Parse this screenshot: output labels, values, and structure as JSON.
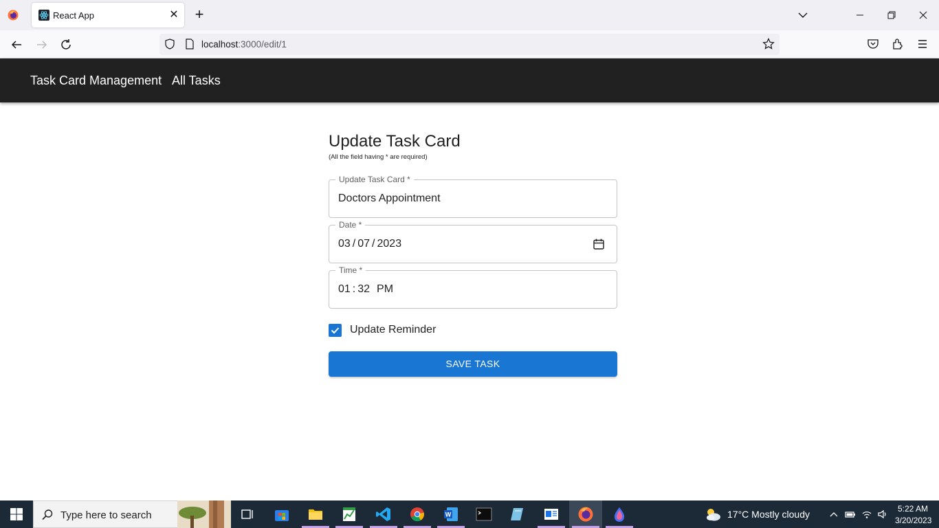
{
  "browser": {
    "tab_title": "React App",
    "url_host": "localhost",
    "url_path": ":3000/edit/1"
  },
  "header": {
    "brand": "Task Card Management",
    "nav_all_tasks": "All Tasks"
  },
  "form": {
    "title": "Update Task Card",
    "note": "(All the field having * are required)",
    "task_label": "Update Task Card *",
    "task_value": "Doctors Appointment",
    "date_label": "Date *",
    "date": {
      "month": "03",
      "day": "07",
      "year": "2023"
    },
    "time_label": "Time *",
    "time": {
      "hour": "01",
      "minute": "32",
      "ampm": "PM"
    },
    "reminder_label": "Update Reminder",
    "reminder_checked": true,
    "save_label": "SAVE TASK"
  },
  "taskbar": {
    "search_placeholder": "Type here to search",
    "weather": "17°C  Mostly cloudy",
    "time": "5:22 AM",
    "date": "3/20/2023"
  },
  "colors": {
    "accent": "#1976d2",
    "header_bg": "#212121"
  }
}
